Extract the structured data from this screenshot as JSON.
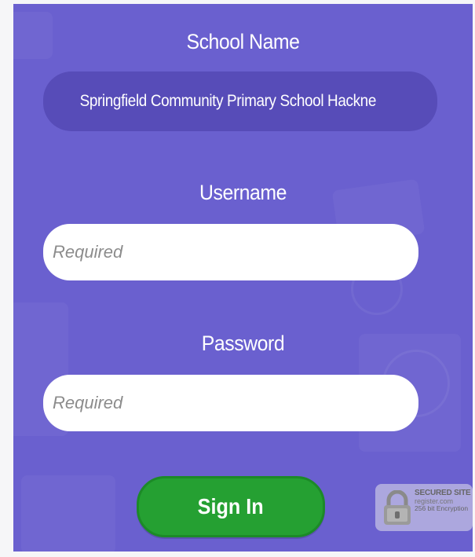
{
  "form": {
    "school_label": "School Name",
    "school_value": "Springfield Community Primary School Hackne",
    "username_label": "Username",
    "username_placeholder": "Required",
    "password_label": "Password",
    "password_placeholder": "Required",
    "signin_label": "Sign In"
  },
  "seal": {
    "line1": "SECURED SITE",
    "line2": "register.com",
    "line3": "256 bit Encryption"
  },
  "colors": {
    "panel_bg": "#6a60cf",
    "school_box": "#574cb8",
    "signin_green": "#25a032"
  }
}
